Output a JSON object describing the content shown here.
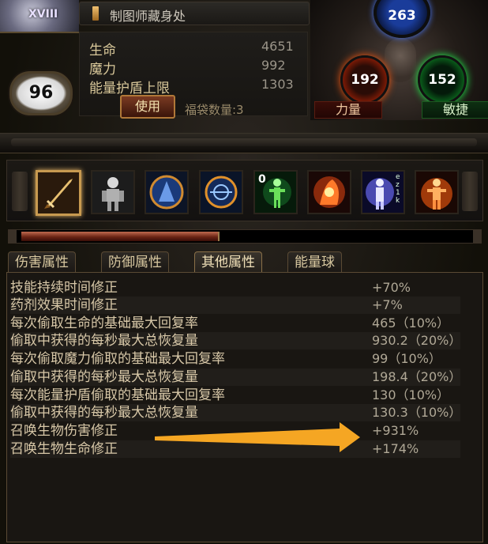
{
  "header": {
    "portrait_label": "XVIII",
    "level": "96",
    "title": "制图师藏身处",
    "stats": [
      {
        "label": "生命",
        "value": "4651"
      },
      {
        "label": "魔力",
        "value": "992"
      },
      {
        "label": "能量护盾上限",
        "value": "1303"
      }
    ],
    "use_button": "使用",
    "bag_count": "福袋数量:3"
  },
  "orbs": {
    "energy": "263",
    "strength": "192",
    "dexterity": "152",
    "strength_label": "力量",
    "dexterity_label": "敏捷"
  },
  "skills": {
    "slots": [
      {
        "icon": "sword-icon",
        "selected": true
      },
      {
        "icon": "skeleton-figure-icon"
      },
      {
        "icon": "blue-warrior-icon"
      },
      {
        "icon": "arcane-ring-icon"
      },
      {
        "icon": "green-aura-figure-icon",
        "badge": "0"
      },
      {
        "icon": "fire-hand-icon"
      },
      {
        "icon": "frost-figure-icon",
        "badge": "e z 1 k"
      },
      {
        "icon": "flame-figure-icon"
      }
    ],
    "progress": 0.44
  },
  "tabs": [
    {
      "label": "伤害属性",
      "active": false
    },
    {
      "label": "防御属性",
      "active": false
    },
    {
      "label": "其他属性",
      "active": true
    },
    {
      "label": "能量球",
      "active": false
    }
  ],
  "properties": [
    {
      "label": "技能持续时间修正",
      "value": "+70%"
    },
    {
      "label": "药剂效果时间修正",
      "value": "+7%"
    },
    {
      "label": "每次偷取生命的基础最大回复率",
      "value": "465（10%）"
    },
    {
      "label": "偷取中获得的每秒最大总恢复量",
      "value": "930.2（20%）"
    },
    {
      "label": "每次偷取魔力偷取的基础最大回复率",
      "value": "99（10%）"
    },
    {
      "label": "偷取中获得的每秒最大总恢复量",
      "value": "198.4（20%）"
    },
    {
      "label": "每次能量护盾偷取的基础最大回复率",
      "value": "130（10%）"
    },
    {
      "label": "偷取中获得的每秒最大总恢复量",
      "value": "130.3（10%）"
    },
    {
      "label": "召唤生物伤害修正",
      "value": "+931%"
    },
    {
      "label": "召唤生物生命修正",
      "value": "+174%"
    }
  ],
  "colors": {
    "accent_gold": "#c89a50",
    "arrow": "#f5a623",
    "strength": "#ff5a10",
    "dexterity": "#20ff50",
    "energy": "#4a7aff"
  }
}
